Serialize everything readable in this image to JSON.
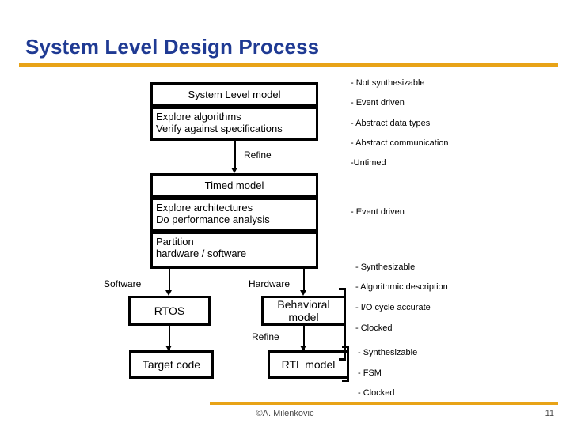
{
  "slide": {
    "title": "System Level Design Process",
    "accent_color": "#E8A317",
    "title_color": "#1F3A93"
  },
  "footer": {
    "credit": "©A. Milenkovic",
    "page_number": "11"
  },
  "diagram": {
    "system_level": {
      "header": "System Level model",
      "body_line1": "Explore algorithms",
      "body_line2": "Verify against specifications"
    },
    "refine_top_label": "Refine",
    "timed": {
      "header": "Timed model",
      "body_line1": "Explore architectures",
      "body_line2": "Do performance analysis",
      "partition_line1": "Partition",
      "partition_line2": "hardware / software"
    },
    "software_label": "Software",
    "hardware_label": "Hardware",
    "rtos": "RTOS",
    "target_code": "Target code",
    "behavioral_line1": "Behavioral",
    "behavioral_line2": "model",
    "refine_hw_label": "Refine",
    "rtl_model": "RTL model"
  },
  "notes": {
    "system_level": [
      "- Not synthesizable",
      "- Event driven",
      "- Abstract data types",
      "- Abstract communication",
      "-Untimed"
    ],
    "timed": [
      "- Event driven"
    ],
    "behavioral": [
      "- Synthesizable",
      "- Algorithmic description",
      "- I/O cycle accurate",
      "- Clocked"
    ],
    "rtl": [
      "- Synthesizable",
      "- FSM",
      "- Clocked"
    ]
  }
}
